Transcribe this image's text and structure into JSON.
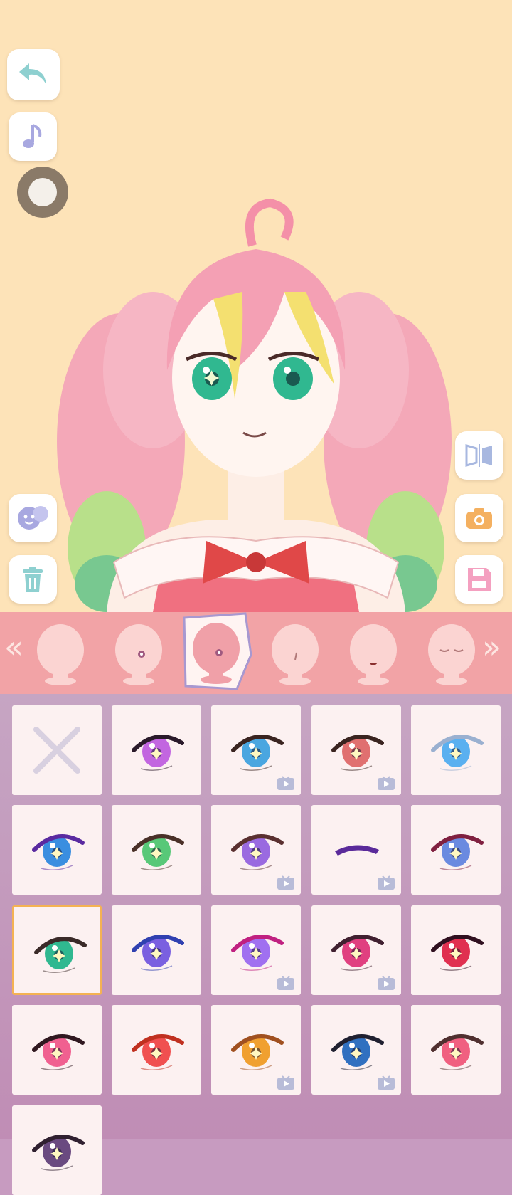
{
  "colors": {
    "stage_bg": "#fde3b8",
    "strip_bg": "#f2a3a6",
    "grid_bg": "#c79bc0",
    "cell_bg": "#fcf1f1",
    "selected_border": "#f4b253"
  },
  "left_tools": [
    {
      "icon": "undo-icon"
    },
    {
      "icon": "music-note-icon"
    },
    {
      "icon": "record-icon"
    },
    {
      "icon": "sticker-face-icon"
    },
    {
      "icon": "trash-icon"
    }
  ],
  "right_tools": [
    {
      "icon": "mirror-flip-icon"
    },
    {
      "icon": "camera-icon"
    },
    {
      "icon": "save-icon"
    }
  ],
  "categories": [
    {
      "icon": "head-base-icon"
    },
    {
      "icon": "head-eye-icon"
    },
    {
      "icon": "head-eye-selected-icon",
      "active": true
    },
    {
      "icon": "head-nose-icon"
    },
    {
      "icon": "head-mouth-icon"
    },
    {
      "icon": "head-brows-icon"
    }
  ],
  "eyes": [
    {
      "id": "none",
      "type": "none"
    },
    {
      "iris": "#c266e0",
      "liner": "#2a1a2a",
      "ad": false
    },
    {
      "iris": "#4aa6e0",
      "liner": "#3a2420",
      "ad": true
    },
    {
      "iris": "#e07070",
      "liner": "#3a2420",
      "ad": true
    },
    {
      "iris": "#5ab0f0",
      "liner": "#9ab0d0",
      "ad": false
    },
    {
      "iris": "#3a8ee0",
      "liner": "#5a2aa0",
      "ad": false
    },
    {
      "iris": "#58c878",
      "liner": "#4a3028",
      "ad": false
    },
    {
      "iris": "#9a6ae0",
      "liner": "#5a3030",
      "ad": true
    },
    {
      "iris": "none",
      "liner": "#5a2a9a",
      "ad": true
    },
    {
      "iris": "#6a8ae0",
      "liner": "#802040",
      "ad": false
    },
    {
      "iris": "#30b890",
      "liner": "#3a2a28",
      "ad": false,
      "selected": true
    },
    {
      "iris": "#7a60e0",
      "liner": "#3040b0",
      "ad": false
    },
    {
      "iris": "#a070f0",
      "liner": "#c02080",
      "ad": true
    },
    {
      "iris": "#e04080",
      "liner": "#402030",
      "ad": true
    },
    {
      "iris": "#e03050",
      "liner": "#301020",
      "ad": false
    },
    {
      "iris": "#f06090",
      "liner": "#301820",
      "ad": false
    },
    {
      "iris": "#f05050",
      "liner": "#c03020",
      "ad": false
    },
    {
      "iris": "#f0a030",
      "liner": "#a05020",
      "ad": true
    },
    {
      "iris": "#3070c0",
      "liner": "#202030",
      "ad": true
    },
    {
      "iris": "#f06080",
      "liner": "#503030",
      "ad": false
    },
    {
      "iris": "#6a4a80",
      "liner": "#302030",
      "ad": false
    }
  ]
}
